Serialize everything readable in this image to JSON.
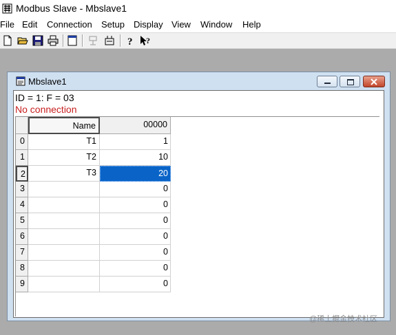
{
  "app": {
    "title": "Modbus Slave - Mbslave1"
  },
  "menu": [
    "File",
    "Edit",
    "Connection",
    "Setup",
    "Display",
    "View",
    "Window",
    "Help"
  ],
  "toolbar": {
    "icons": [
      "new-file-icon",
      "open-folder-icon",
      "save-icon",
      "print-icon",
      "window-icon",
      "connect-icon",
      "disconnect-icon",
      "help-icon",
      "context-help-icon"
    ]
  },
  "child_window": {
    "title": "Mbslave1",
    "info_line": "ID = 1: F = 03",
    "status": "No connection",
    "status_color": "#c81e1e",
    "grid": {
      "headers": [
        "Name",
        "00000"
      ],
      "rows": [
        {
          "index": "0",
          "name": "T1",
          "value": "1"
        },
        {
          "index": "1",
          "name": "T2",
          "value": "10"
        },
        {
          "index": "2",
          "name": "T3",
          "value": "20",
          "selected": true
        },
        {
          "index": "3",
          "name": "",
          "value": "0"
        },
        {
          "index": "4",
          "name": "",
          "value": "0"
        },
        {
          "index": "5",
          "name": "",
          "value": "0"
        },
        {
          "index": "6",
          "name": "",
          "value": "0"
        },
        {
          "index": "7",
          "name": "",
          "value": "0"
        },
        {
          "index": "8",
          "name": "",
          "value": "0"
        },
        {
          "index": "9",
          "name": "",
          "value": "0"
        }
      ],
      "selection_color": "#0a64c8"
    }
  },
  "watermark": "@稀土掘金技术社区"
}
